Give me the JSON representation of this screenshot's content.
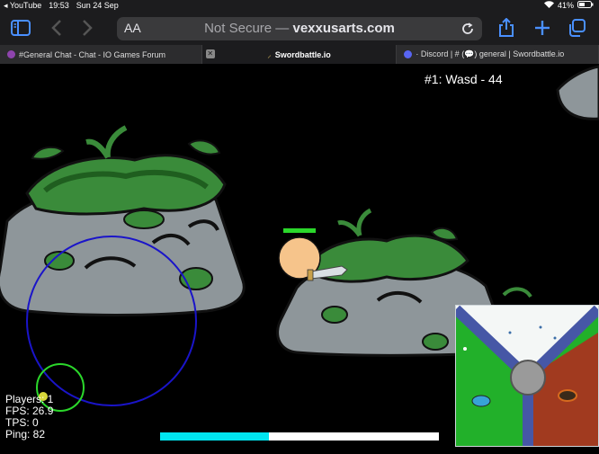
{
  "status": {
    "back_app": "◂ YouTube",
    "time": "19:53",
    "date": "Sun 24 Sep",
    "battery": "41%"
  },
  "browser": {
    "aa_label": "AA",
    "not_secure": "Not Secure —",
    "domain": "vexxusarts.com",
    "tabs": [
      {
        "label": "#General Chat - Chat - IO Games Forum"
      },
      {
        "label": "Swordbattle.io"
      },
      {
        "label": "· Discord | # (💬) general | Swordbattle.io"
      }
    ]
  },
  "game": {
    "leaderboard": "#1: Wasd - 44",
    "stats": {
      "players": "Players: 1",
      "fps": "FPS: 26.9",
      "tps": "TPS: 0",
      "ping": "Ping: 82"
    },
    "progress": 0.39,
    "colors": {
      "progress": "#00e5f0",
      "health": "#2bd82b",
      "player": "#f6c48b",
      "range_ring": "#1a14c9"
    }
  }
}
